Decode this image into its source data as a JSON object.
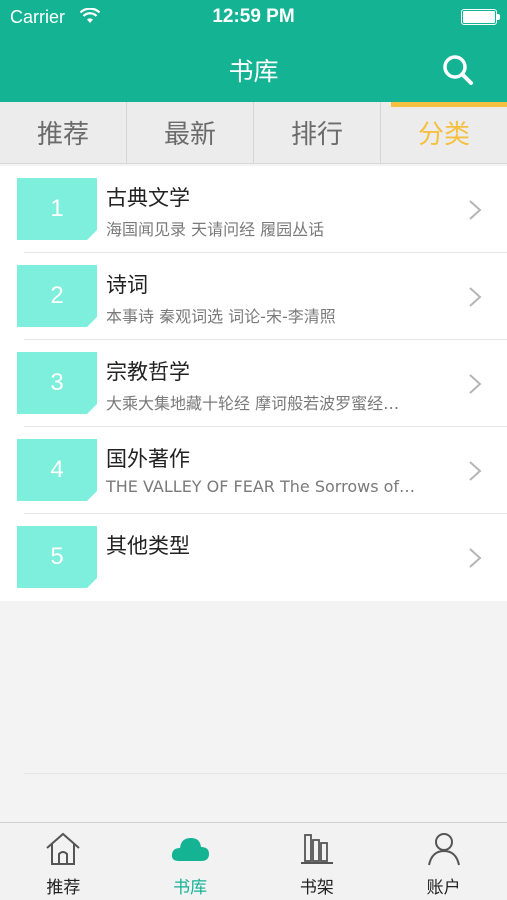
{
  "status_bar": {
    "carrier": "Carrier",
    "time": "12:59 PM"
  },
  "nav": {
    "title": "书库",
    "search_icon": "search-icon"
  },
  "tabs": [
    {
      "label": "推荐",
      "active": false
    },
    {
      "label": "最新",
      "active": false
    },
    {
      "label": "排行",
      "active": false
    },
    {
      "label": "分类",
      "active": true
    }
  ],
  "categories": [
    {
      "number": "1",
      "title": "古典文学",
      "subtitle": "海国闻见录  天请问经  履园丛话"
    },
    {
      "number": "2",
      "title": "诗词",
      "subtitle": "本事诗  秦观词选  词论-宋-李清照"
    },
    {
      "number": "3",
      "title": "宗教哲学",
      "subtitle": "大乘大集地藏十轮经  摩诃般若波罗蜜经…"
    },
    {
      "number": "4",
      "title": "国外著作",
      "subtitle": "THE VALLEY OF FEAR  The Sorrows of…"
    },
    {
      "number": "5",
      "title": "其他类型",
      "subtitle": ""
    }
  ],
  "tabbar": [
    {
      "label": "推荐",
      "icon": "home-icon",
      "active": false
    },
    {
      "label": "书库",
      "icon": "cloud-icon",
      "active": true
    },
    {
      "label": "书架",
      "icon": "bookshelf-icon",
      "active": false
    },
    {
      "label": "账户",
      "icon": "user-icon",
      "active": false
    }
  ],
  "colors": {
    "primary": "#14b394",
    "accent": "#f5c040",
    "badge": "#7eeedd"
  }
}
